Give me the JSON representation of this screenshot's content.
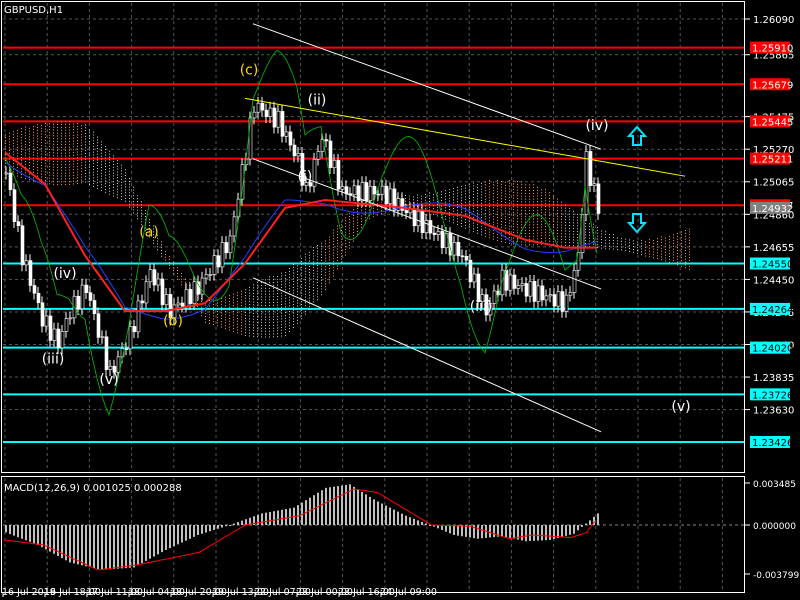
{
  "chart_data": {
    "type": "candlestick",
    "title": "GBPUSD,H1",
    "price_ticks": [
      "1.26090",
      "1.25865",
      "1.25475",
      "1.25270",
      "1.25065",
      "1.24860",
      "1.24655",
      "1.24450",
      "1.24245",
      "1.24040",
      "1.23835",
      "1.23630"
    ],
    "price_tick_values": [
      1.2609,
      1.25865,
      1.25475,
      1.2527,
      1.25065,
      1.2486,
      1.24655,
      1.2445,
      1.24245,
      1.2404,
      1.23835,
      1.2363
    ],
    "resistance_levels": [
      1.2591,
      1.25679,
      1.25445,
      1.25211,
      1.24917
    ],
    "resistance_labels": [
      "1.25910",
      "1.25679",
      "1.25445",
      "1.25211",
      "1.24917"
    ],
    "support_levels": [
      1.2455,
      1.24264,
      1.2402,
      1.23726,
      1.23426
    ],
    "support_labels": [
      "1.24550",
      "1.24264",
      "1.24020",
      "1.23726",
      "1.23426"
    ],
    "current_price_label": "1.24932",
    "current_price": 1.24932,
    "time_labels": [
      "16 Jul 2019",
      "16 Jul 18:00",
      "17 Jul 11:00",
      "18 Jul 04:00",
      "18 Jul 20:00",
      "19 Jul 13:00",
      "22 Jul 07:00",
      "23 Jul 00:00",
      "23 Jul 16:00",
      "24 Jul 09:00"
    ],
    "close_keypoints": [
      [
        0,
        1.2512
      ],
      [
        4,
        1.246
      ],
      [
        9,
        1.242
      ],
      [
        13,
        1.2405
      ],
      [
        16,
        1.2425
      ],
      [
        20,
        1.244
      ],
      [
        26,
        1.2385
      ],
      [
        31,
        1.241
      ],
      [
        36,
        1.245
      ],
      [
        41,
        1.2425
      ],
      [
        48,
        1.244
      ],
      [
        56,
        1.247
      ],
      [
        62,
        1.2555
      ],
      [
        68,
        1.2545
      ],
      [
        73,
        1.252
      ],
      [
        75,
        1.25
      ],
      [
        79,
        1.2535
      ],
      [
        84,
        1.25
      ],
      [
        94,
        1.25
      ],
      [
        104,
        1.248
      ],
      [
        114,
        1.246
      ],
      [
        120,
        1.2425
      ],
      [
        124,
        1.2445
      ],
      [
        134,
        1.2435
      ],
      [
        140,
        1.243
      ],
      [
        143,
        1.246
      ],
      [
        145,
        1.252
      ],
      [
        148,
        1.249
      ]
    ],
    "ma_keypoints": [
      [
        0,
        1.2525
      ],
      [
        10,
        1.2505
      ],
      [
        20,
        1.246
      ],
      [
        30,
        1.2425
      ],
      [
        40,
        1.2425
      ],
      [
        50,
        1.243
      ],
      [
        60,
        1.2455
      ],
      [
        70,
        1.249
      ],
      [
        80,
        1.2495
      ],
      [
        100,
        1.249
      ],
      [
        115,
        1.2485
      ],
      [
        130,
        1.247
      ],
      [
        140,
        1.2465
      ],
      [
        148,
        1.2465
      ]
    ],
    "wave_labels": [
      {
        "text": "(c)",
        "bar": 61,
        "price": 1.2574,
        "color": "#ffd700"
      },
      {
        "text": "(ii)",
        "bar": 78,
        "price": 1.2555,
        "color": "#ffffff"
      },
      {
        "text": "(i)",
        "bar": 75,
        "price": 1.2507,
        "color": "#ffffff"
      },
      {
        "text": "(a)",
        "bar": 36,
        "price": 1.2472,
        "color": "#ffd700"
      },
      {
        "text": "(iv)",
        "bar": 15,
        "price": 1.2446,
        "color": "#ffffff"
      },
      {
        "text": "(b)",
        "bar": 42,
        "price": 1.2416,
        "color": "#ffd700"
      },
      {
        "text": "(iii)",
        "bar": 12,
        "price": 1.2392,
        "color": "#ffffff"
      },
      {
        "text": "(v)",
        "bar": 26,
        "price": 1.2379,
        "color": "#ffffff"
      },
      {
        "text": "(iii)",
        "bar": 119,
        "price": 1.2425,
        "color": "#ffffff"
      },
      {
        "text": "(iv)",
        "bar": 148,
        "price": 1.2539,
        "color": "#ffffff"
      },
      {
        "text": "(v)",
        "bar": 169,
        "price": 1.2362,
        "color": "#ffffff"
      }
    ],
    "trendlines": [
      {
        "color": "#ffffff",
        "from": [
          62,
          1.2606
        ],
        "to": [
          149,
          1.2527
        ]
      },
      {
        "color": "#ffffff",
        "from": [
          62,
          1.2521
        ],
        "to": [
          149,
          1.2439
        ]
      },
      {
        "color": "#ffffff",
        "from": [
          62,
          1.2446
        ],
        "to": [
          149,
          1.2349
        ]
      },
      {
        "color": "#ffff00",
        "from": [
          60,
          1.2559
        ],
        "to": [
          170,
          1.251
        ]
      }
    ],
    "macd": {
      "label": "MACD(12,26,9) 0.001025 0.000288",
      "ticks": [
        "0.003485",
        "0.000000",
        "-0.003799"
      ],
      "tick_values": [
        0.003485,
        0,
        -0.003799
      ],
      "hist_keypoints": [
        [
          0,
          -0.0006
        ],
        [
          8,
          -0.0016
        ],
        [
          16,
          -0.003
        ],
        [
          24,
          -0.0036
        ],
        [
          32,
          -0.0034
        ],
        [
          40,
          -0.002
        ],
        [
          48,
          -0.0008
        ],
        [
          56,
          0
        ],
        [
          64,
          0.001
        ],
        [
          72,
          0.0015
        ],
        [
          80,
          0.0032
        ],
        [
          86,
          0.0035
        ],
        [
          92,
          0.0022
        ],
        [
          100,
          0.0008
        ],
        [
          106,
          0
        ],
        [
          112,
          -0.0008
        ],
        [
          118,
          -0.0011
        ],
        [
          124,
          -0.0009
        ],
        [
          130,
          -0.0013
        ],
        [
          136,
          -0.0012
        ],
        [
          142,
          -0.0007
        ],
        [
          146,
          0.0004
        ],
        [
          148,
          0.001
        ]
      ],
      "signal_keypoints": [
        [
          0,
          -0.0012
        ],
        [
          10,
          -0.0016
        ],
        [
          24,
          -0.0036
        ],
        [
          34,
          -0.0032
        ],
        [
          50,
          -0.0022
        ],
        [
          62,
          0
        ],
        [
          76,
          0.0008
        ],
        [
          90,
          0.0031
        ],
        [
          96,
          0.0028
        ],
        [
          110,
          0
        ],
        [
          120,
          -0.0001
        ],
        [
          130,
          -0.0011
        ],
        [
          136,
          -0.0008
        ],
        [
          146,
          -0.001
        ],
        [
          150,
          -0.0006
        ],
        [
          152,
          0.0003
        ]
      ]
    }
  }
}
